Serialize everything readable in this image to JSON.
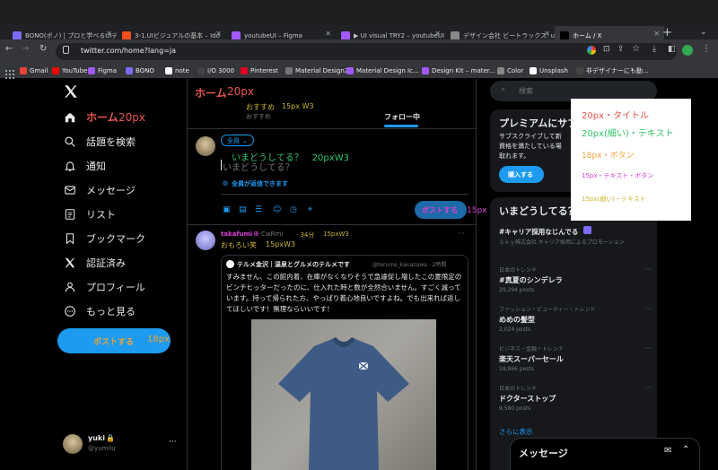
{
  "browser": {
    "tabs": [
      {
        "title": "BONO(ボノ) | プロと学べるUIデ",
        "icon_color": "#7b6cf6"
      },
      {
        "title": "3-1.UIビジュアルの基本 – Ido",
        "icon_color": "#f24e1e"
      },
      {
        "title": "youtubeUI – Figma",
        "icon_color": "#a259ff"
      },
      {
        "title": "▶ UI visual TRY2 – youtubeUI",
        "icon_color": "#a259ff"
      },
      {
        "title": "デザイン会社 ビートラックス: ux",
        "icon_color": "#888888"
      },
      {
        "title": "ホーム / X",
        "icon_color": "#000000"
      }
    ],
    "url": "twitter.com/home?lang=ja",
    "bookmarks": [
      {
        "label": "Gmail",
        "color": "#ea4335"
      },
      {
        "label": "YouTube",
        "color": "#ff0000"
      },
      {
        "label": "Figma",
        "color": "#a259ff"
      },
      {
        "label": "BONO",
        "color": "#7b6cf6"
      },
      {
        "label": "note",
        "color": "#ffffff"
      },
      {
        "label": "I/O 3000",
        "color": "#444444"
      },
      {
        "label": "Pinterest",
        "color": "#e60023"
      },
      {
        "label": "Material Design2",
        "color": "#757575"
      },
      {
        "label": "Material Design Ic...",
        "color": "#a259ff"
      },
      {
        "label": "Design Kit – mater...",
        "color": "#a259ff"
      },
      {
        "label": "Color",
        "color": "#888888"
      },
      {
        "label": "Unsplash",
        "color": "#ffffff"
      },
      {
        "label": "非デザイナーにも動...",
        "color": "#444444"
      }
    ]
  },
  "nav": {
    "items": [
      {
        "label": "ホーム",
        "icon": "home-icon"
      },
      {
        "label": "話題を検索",
        "icon": "search-icon"
      },
      {
        "label": "通知",
        "icon": "bell-icon"
      },
      {
        "label": "メッセージ",
        "icon": "mail-icon"
      },
      {
        "label": "リスト",
        "icon": "list-icon"
      },
      {
        "label": "ブックマーク",
        "icon": "bookmark-icon"
      },
      {
        "label": "認証済み",
        "icon": "x-logo-icon"
      },
      {
        "label": "プロフィール",
        "icon": "person-icon"
      },
      {
        "label": "もっと見る",
        "icon": "more-icon"
      }
    ],
    "home_note": "20px",
    "post_button": "ポストする",
    "post_note": "18px",
    "user_name": "yuki",
    "user_handle": "@yumliu"
  },
  "main": {
    "title": "ホーム",
    "title_note": "20px",
    "tab_recommended": "おすすめ",
    "tab_recommended_small": "おすすめ",
    "tab_recommended_note": "15px W3",
    "tab_following": "フォロー中",
    "audience": "全員",
    "compose_note": "いまどうしてる？　20pxW3",
    "compose_placeholder": "いまどうしてる？",
    "reply_setting": "全員が返信できます",
    "post_button": "ポストする",
    "post_note": "15px"
  },
  "tweet": {
    "name": "takafumi",
    "name_suffix": "CwRmi",
    "time": "· 34分",
    "name_note": "15pxW3",
    "text": "おもろい笑",
    "text_note": "15pxW3",
    "quote_name": "テルメ金沢｜温泉とグルメのテルメです",
    "quote_handle": "@terume_kanazawa · 2時間",
    "quote_text": "すみません、この館内着、在庫がなくなりそうで急遽促し増したこの夏限定のビンチヒッターだったのに、仕入れた時と数が全然合いません。すごく減っています。持って帰られた方、やっぱり着心地良いですよね。でも出来れば返してほしいです！無理ならいいです！"
  },
  "right": {
    "search_placeholder": "検索",
    "premium_title": "プレミアムにサブ",
    "premium_text_lines": [
      "サブスクライブして新",
      "資格を満たしている場",
      "取れます。"
    ],
    "premium_button": "購入する",
    "trends_title": "いまどうしてる？",
    "promo_hashtag": "#キャリア採用なじんでる",
    "promo_text": "Ｓｋｙ株式会社 キャリア採用によるプロモーション",
    "trends": [
      {
        "meta": "日本のトレンド",
        "name": "#真夏のシンデレラ",
        "count": "29,294 posts"
      },
      {
        "meta": "ファッション・ビューティー・トレンド",
        "name": "めめの髪型",
        "count": "2,024 posts"
      },
      {
        "meta": "ビジネス・金融・トレンド",
        "name": "楽天スーパーセール",
        "count": "18,866 posts"
      },
      {
        "meta": "日本のトレンド",
        "name": "ドクターストップ",
        "count": "9,580 posts"
      }
    ],
    "show_more": "さらに表示",
    "messages": "メッセージ"
  },
  "legend": {
    "items": [
      {
        "text": "20px・タイトル",
        "color": "#e8564f"
      },
      {
        "text": "20px(細い)・テキスト",
        "color": "#33c56a"
      },
      {
        "text": "18px・ボタン",
        "color": "#f0a23a"
      },
      {
        "text": "15px・テキスト・ボタン",
        "color": "#d940d6"
      },
      {
        "text": "15px(細い)・テキスト",
        "color": "#c8b62e"
      }
    ]
  },
  "colors": {
    "accent": "#1d9bf0",
    "title_red": "#e8564f",
    "green": "#33c56a",
    "orange": "#f0a23a",
    "magenta": "#d940d6",
    "yellow": "#c8b62e"
  }
}
